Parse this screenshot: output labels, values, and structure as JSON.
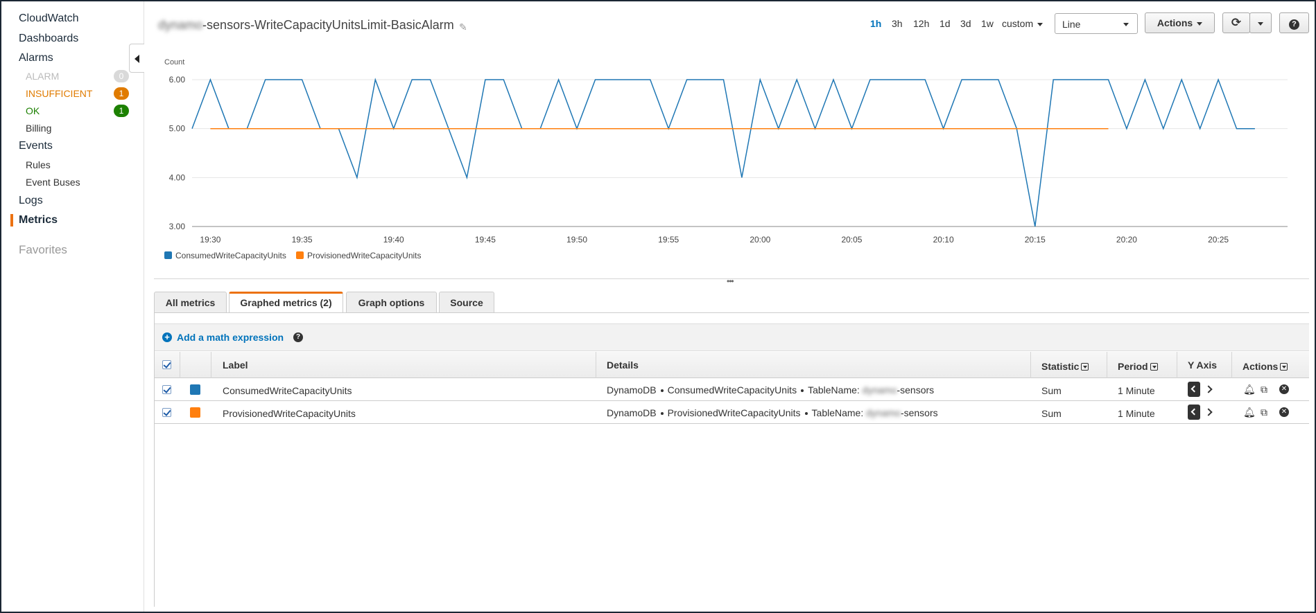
{
  "sidebar": {
    "cloudwatch": "CloudWatch",
    "dashboards": "Dashboards",
    "alarms": "Alarms",
    "alarm": {
      "label": "ALARM",
      "count": "0",
      "color": "#cccccc"
    },
    "insufficient": {
      "label": "INSUFFICIENT",
      "count": "1",
      "color": "#e07b00"
    },
    "ok": {
      "label": "OK",
      "count": "1",
      "color": "#1d8102"
    },
    "billing": "Billing",
    "events": "Events",
    "rules": "Rules",
    "event_buses": "Event Buses",
    "logs": "Logs",
    "metrics": "Metrics",
    "favorites": "Favorites"
  },
  "header": {
    "title_blurred": "dynamo",
    "title": "-sensors-WriteCapacityUnitsLimit-BasicAlarm",
    "ranges": [
      "1h",
      "3h",
      "12h",
      "1d",
      "3d",
      "1w"
    ],
    "selected_range": "1h",
    "custom": "custom",
    "graph_type": "Line",
    "actions": "Actions"
  },
  "chart_data": {
    "type": "line",
    "ylabel": "Count",
    "yticks": [
      "3.00",
      "4.00",
      "5.00",
      "6.00"
    ],
    "ylim": [
      3,
      6
    ],
    "xticks": [
      "19:30",
      "19:35",
      "19:40",
      "19:45",
      "19:50",
      "19:55",
      "20:00",
      "20:05",
      "20:10",
      "20:15",
      "20:20",
      "20:25"
    ],
    "x_start": "19:29",
    "series": [
      {
        "name": "ConsumedWriteCapacityUnits",
        "color": "#1f77b4",
        "values": [
          5,
          6,
          5,
          5,
          6,
          6,
          6,
          5,
          5,
          4,
          6,
          5,
          6,
          6,
          5,
          4,
          6,
          6,
          5,
          5,
          6,
          5,
          6,
          6,
          6,
          6,
          5,
          6,
          6,
          6,
          4,
          6,
          5,
          6,
          5,
          6,
          5,
          6,
          6,
          6,
          6,
          5,
          6,
          6,
          6,
          5,
          3,
          6,
          6,
          6,
          6,
          5,
          6,
          5,
          6,
          5,
          6,
          5,
          5
        ]
      },
      {
        "name": "ProvisionedWriteCapacityUnits",
        "color": "#ff7f0e",
        "x_start": "19:30",
        "x_end": "20:19",
        "values": [
          5,
          5
        ]
      }
    ]
  },
  "tabs": [
    "All metrics",
    "Graphed metrics (2)",
    "Graph options",
    "Source"
  ],
  "math": {
    "add": "Add a math expression"
  },
  "table": {
    "headers": {
      "label": "Label",
      "details": "Details",
      "statistic": "Statistic",
      "period": "Period",
      "yaxis": "Y Axis",
      "actions": "Actions"
    },
    "rows": [
      {
        "label": "ConsumedWriteCapacityUnits",
        "color": "#1f77b4",
        "ns": "DynamoDB",
        "metric": "ConsumedWriteCapacityUnits",
        "table_key": "TableName:",
        "table_blur": "dynamo",
        "table_suffix": "-sensors",
        "statistic": "Sum",
        "period": "1 Minute"
      },
      {
        "label": "ProvisionedWriteCapacityUnits",
        "color": "#ff7f0e",
        "ns": "DynamoDB",
        "metric": "ProvisionedWriteCapacityUnits",
        "table_key": "TableName:",
        "table_blur": "dynamo",
        "table_suffix": "-sensors",
        "statistic": "Sum",
        "period": "1 Minute"
      }
    ]
  }
}
